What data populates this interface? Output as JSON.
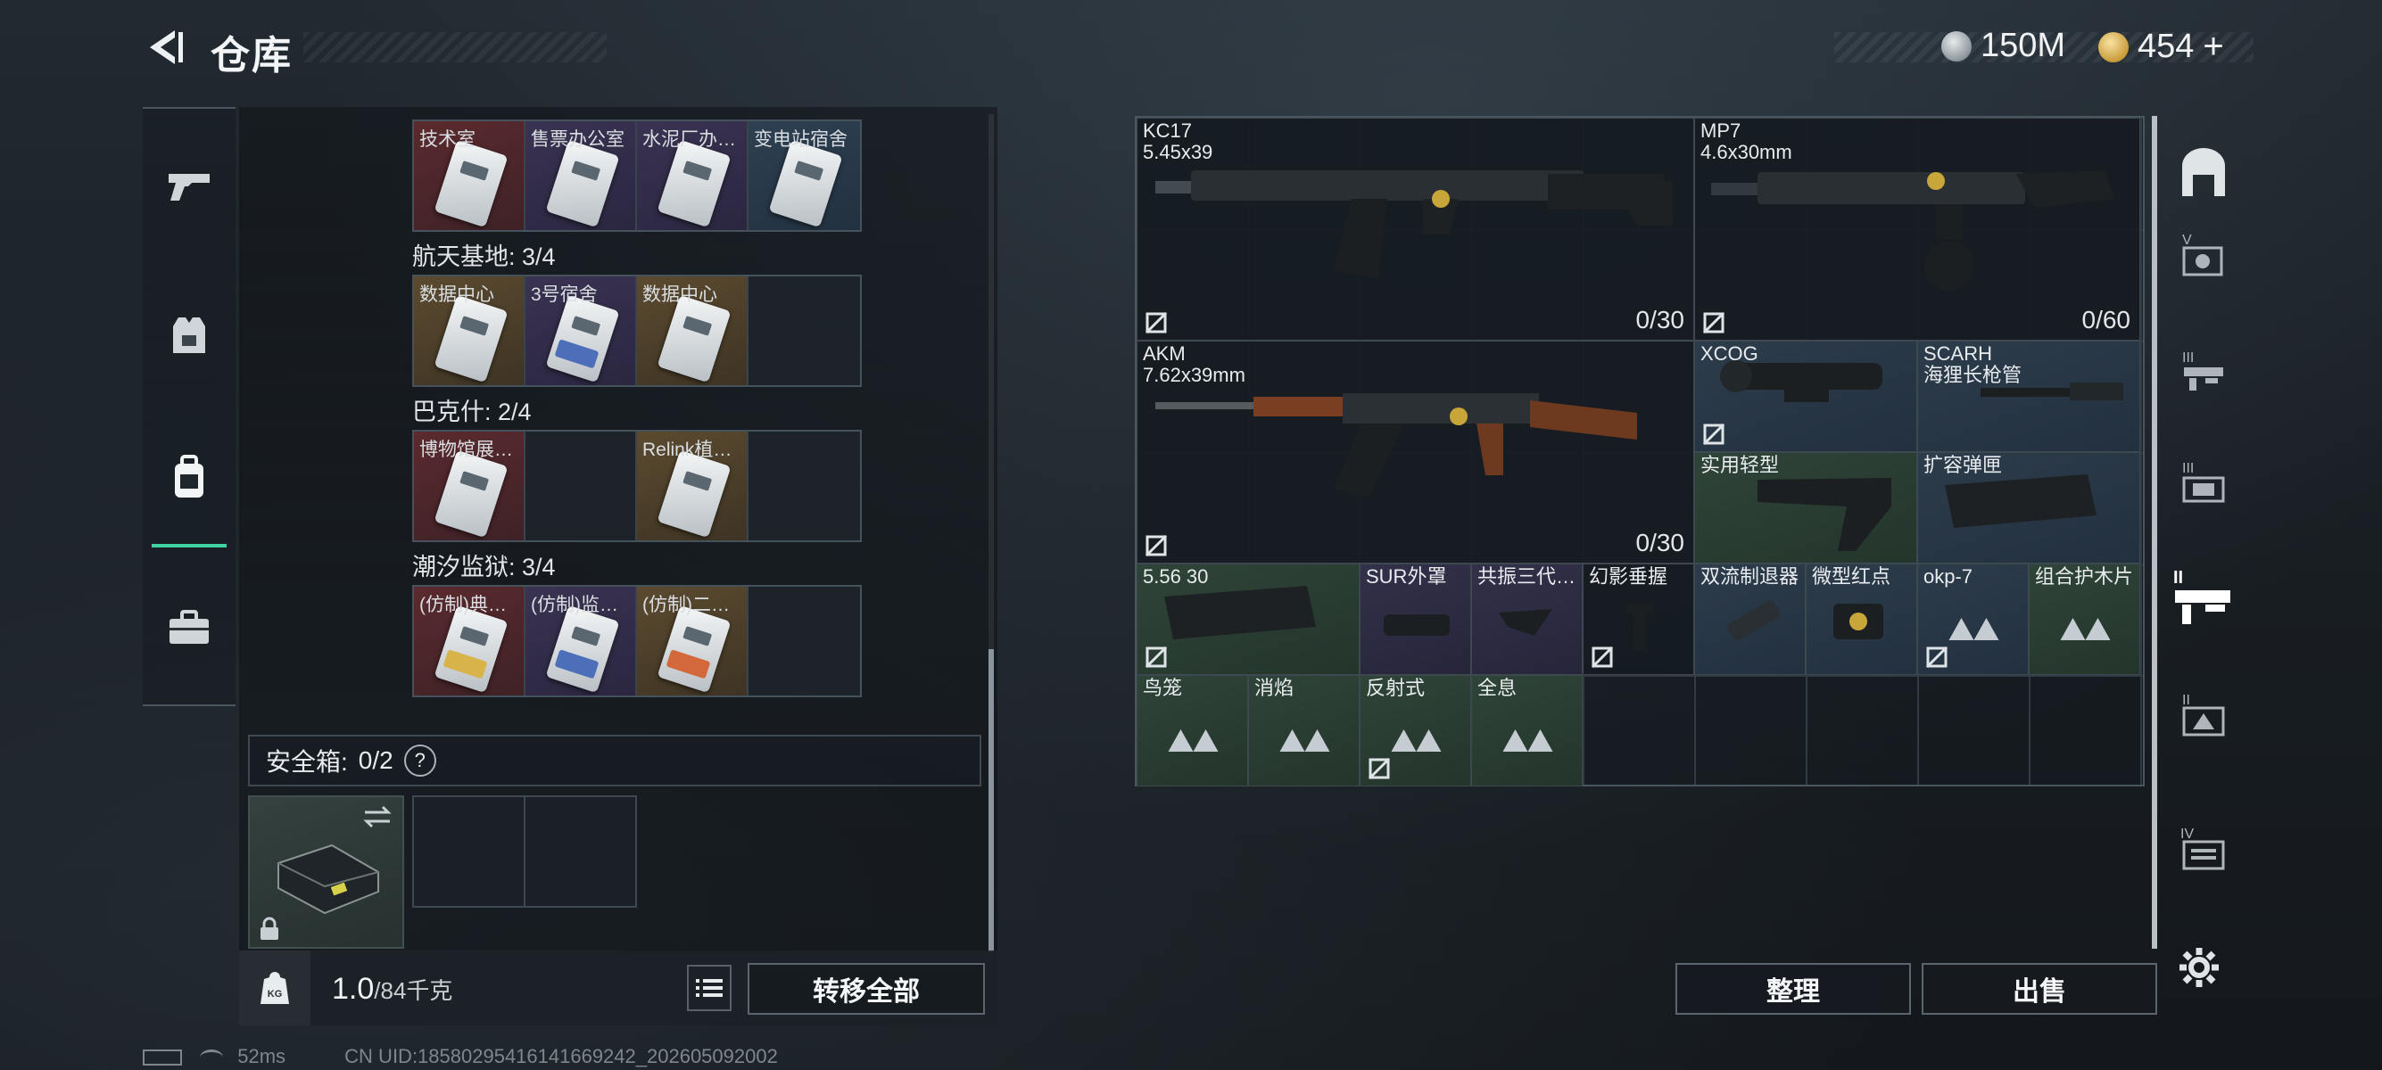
{
  "header": {
    "title": "仓库",
    "currency1": "150M",
    "currency2": "454",
    "currency2_plus": "+"
  },
  "left": {
    "groups": [
      {
        "label": "",
        "cells": [
          {
            "name": "技术室",
            "color": "red",
            "card": ""
          },
          {
            "name": "售票办公室",
            "color": "purple",
            "card": ""
          },
          {
            "name": "水泥厂办…",
            "color": "purple",
            "card": ""
          },
          {
            "name": "变电站宿舍",
            "color": "blue",
            "card": ""
          }
        ]
      },
      {
        "label": "航天基地: 3/4",
        "cells": [
          {
            "name": "数据中心",
            "color": "gold",
            "card": ""
          },
          {
            "name": "3号宿舍",
            "color": "purple",
            "card": "b"
          },
          {
            "name": "数据中心",
            "color": "gold",
            "card": ""
          },
          {
            "name": "",
            "color": "empty",
            "card": ""
          }
        ]
      },
      {
        "label": "巴克什: 2/4",
        "cells": [
          {
            "name": "博物馆展…",
            "color": "red",
            "card": ""
          },
          {
            "name": "",
            "color": "empty",
            "card": ""
          },
          {
            "name": "Relink植…",
            "color": "gold",
            "card": ""
          },
          {
            "name": "",
            "color": "empty",
            "card": ""
          }
        ]
      },
      {
        "label": "潮汐监狱: 3/4",
        "cells": [
          {
            "name": "(仿制)典…",
            "color": "red",
            "card": "g"
          },
          {
            "name": "(仿制)监…",
            "color": "purple",
            "card": "b"
          },
          {
            "name": "(仿制)二…",
            "color": "gold",
            "card": "o"
          },
          {
            "name": "",
            "color": "empty",
            "card": ""
          }
        ]
      }
    ],
    "safe_label": "安全箱:",
    "safe_count": "0/2",
    "safe_help": "?",
    "weight": "1.0",
    "weight_max": "/84千克",
    "kg_icon": "KG",
    "transfer_all": "转移全部"
  },
  "right": {
    "items": [
      {
        "id": "kc17",
        "name": "KC17",
        "sub": "5.45x39",
        "ammo": "0/30",
        "bg": "dark",
        "nobuy": true,
        "icon": "rifle-kc17-icon"
      },
      {
        "id": "mp7",
        "name": "MP7",
        "sub": "4.6x30mm",
        "ammo": "0/60",
        "bg": "dark",
        "nobuy": true,
        "icon": "smg-mp7-icon"
      },
      {
        "id": "akm",
        "name": "AKM",
        "sub": "7.62x39mm",
        "ammo": "0/30",
        "bg": "dark",
        "nobuy": true,
        "icon": "rifle-akm-icon"
      },
      {
        "id": "xcog",
        "name": "XCOG",
        "sub": "",
        "ammo": "",
        "bg": "bluebg",
        "nobuy": true,
        "icon": "scope-icon"
      },
      {
        "id": "scarh",
        "name": "SCARH",
        "sub": "海狸长枪管",
        "ammo": "",
        "bg": "bluebg",
        "nobuy": false,
        "icon": "barrel-icon"
      },
      {
        "id": "stock",
        "name": "实用轻型",
        "sub": "",
        "ammo": "",
        "bg": "green",
        "nobuy": false,
        "icon": "stock-icon"
      },
      {
        "id": "mag",
        "name": "扩容弹匣",
        "sub": "",
        "ammo": "",
        "bg": "bluebg",
        "nobuy": false,
        "icon": "magazine-icon"
      },
      {
        "id": "m556",
        "name": "5.56 30",
        "sub": "",
        "ammo": "",
        "bg": "green",
        "nobuy": true,
        "icon": "magazine-icon"
      },
      {
        "id": "sur",
        "name": "SUR外罩",
        "sub": "",
        "ammo": "",
        "bg": "purplebg",
        "nobuy": false,
        "icon": "handguard-icon"
      },
      {
        "id": "gongzhen",
        "name": "共振三代…",
        "sub": "",
        "ammo": "",
        "bg": "purplebg",
        "nobuy": false,
        "icon": "grip-icon"
      },
      {
        "id": "huanying",
        "name": "幻影垂握",
        "sub": "",
        "ammo": "",
        "bg": "dark",
        "nobuy": true,
        "icon": "vertical-grip-icon"
      },
      {
        "id": "shuangliu",
        "name": "双流制退器",
        "sub": "",
        "ammo": "",
        "bg": "bluebg",
        "nobuy": false,
        "icon": "muzzle-icon"
      },
      {
        "id": "weixing",
        "name": "微型红点",
        "sub": "",
        "ammo": "",
        "bg": "bluebg",
        "nobuy": false,
        "icon": "red-dot-icon"
      },
      {
        "id": "okp7",
        "name": "okp-7",
        "sub": "",
        "ammo": "",
        "bg": "bluebg",
        "nobuy": true,
        "icon": "placeholder-triangle-icon"
      },
      {
        "id": "zuhe",
        "name": "组合护木片",
        "sub": "",
        "ammo": "",
        "bg": "green",
        "nobuy": false,
        "icon": "placeholder-triangle-icon"
      },
      {
        "id": "niaolong",
        "name": "鸟笼",
        "sub": "",
        "ammo": "",
        "bg": "green",
        "nobuy": false,
        "icon": "placeholder-triangle-icon"
      },
      {
        "id": "xiaoyan",
        "name": "消焰",
        "sub": "",
        "ammo": "",
        "bg": "green",
        "nobuy": false,
        "icon": "placeholder-triangle-icon"
      },
      {
        "id": "fanshe",
        "name": "反射式",
        "sub": "",
        "ammo": "",
        "bg": "green",
        "nobuy": true,
        "icon": "placeholder-triangle-icon"
      },
      {
        "id": "quanxi",
        "name": "全息",
        "sub": "",
        "ammo": "",
        "bg": "green",
        "nobuy": false,
        "icon": "placeholder-triangle-icon"
      }
    ],
    "sort": "整理",
    "sell": "出售"
  },
  "status": {
    "ping": "52ms",
    "uid": "CN UID:18580295416141669242_202605092002"
  },
  "colors": {
    "accent": "#3fd2a2",
    "green_item": "#2f4438",
    "blue_item": "#2d3c4b",
    "purple_item": "#33314a",
    "red_item": "#5a2a2e",
    "gold_item": "#5b4a2f"
  }
}
